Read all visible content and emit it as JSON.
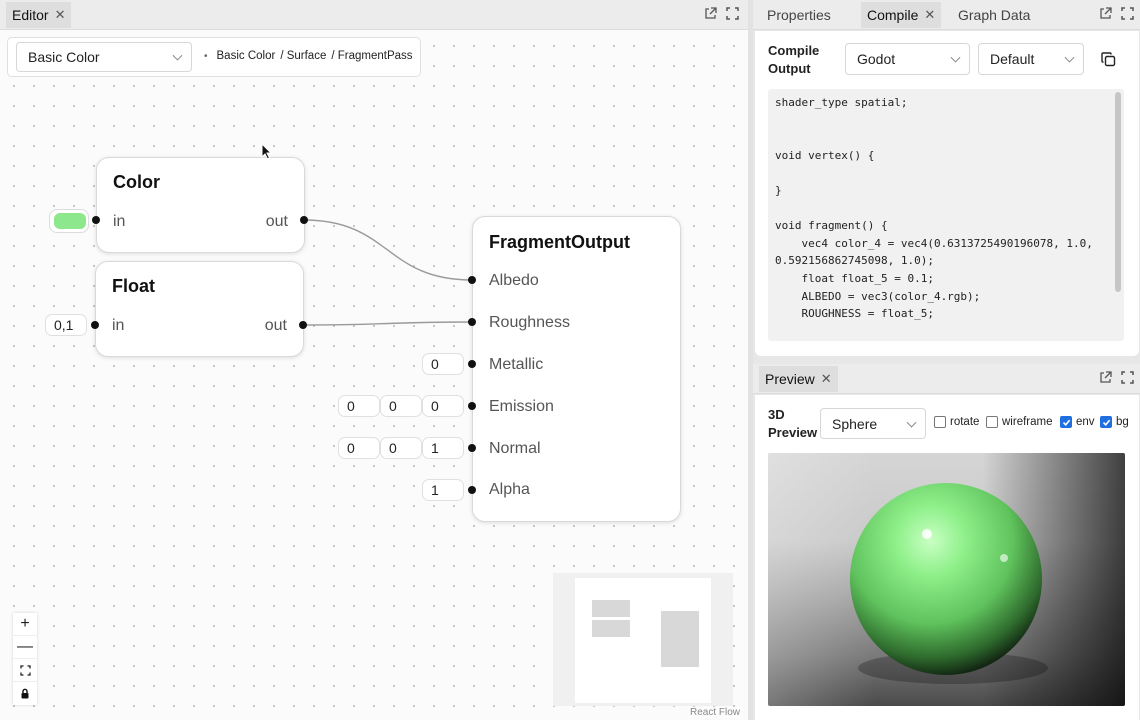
{
  "editor": {
    "tab_label": "Editor",
    "shader_select": "Basic Color",
    "breadcrumb": [
      "Basic Color",
      "/ Surface",
      "/ FragmentPass"
    ],
    "nodes": {
      "color": {
        "title": "Color",
        "in": "in",
        "out": "out",
        "swatch_color": "#8de88d"
      },
      "float": {
        "title": "Float",
        "in": "in",
        "out": "out",
        "value": "0,1"
      },
      "output": {
        "title": "FragmentOutput",
        "albedo": "Albedo",
        "roughness": "Roughness",
        "metallic": "Metallic",
        "metallic_value": "0",
        "emission": "Emission",
        "emission_values": [
          "0",
          "0",
          "0"
        ],
        "normal": "Normal",
        "normal_values": [
          "0",
          "0",
          "1"
        ],
        "alpha": "Alpha",
        "alpha_value": "1"
      }
    },
    "controls": {
      "zoom_in": "+",
      "zoom_out": "—"
    },
    "attribution": "React Flow"
  },
  "right_tabs": {
    "properties": "Properties",
    "compile": "Compile",
    "graph_data": "Graph Data"
  },
  "compile": {
    "label_line1": "Compile",
    "label_line2": "Output",
    "target": "Godot",
    "profile": "Default",
    "code": "shader_type spatial;\n\n\nvoid vertex() {\n\n}\n\nvoid fragment() {\n    vec4 color_4 = vec4(0.6313725490196078, 1.0,\n0.592156862745098, 1.0);\n    float float_5 = 0.1;\n    ALBEDO = vec3(color_4.rgb);\n    ROUGHNESS = float_5;"
  },
  "preview": {
    "tab_label": "Preview",
    "label_line1": "3D",
    "label_line2": "Preview",
    "shape": "Sphere",
    "options": [
      {
        "label": "rotate",
        "checked": false
      },
      {
        "label": "wireframe",
        "checked": false
      },
      {
        "label": "env",
        "checked": true
      },
      {
        "label": "bg",
        "checked": true
      }
    ],
    "sphere_color": "#7fe07f"
  }
}
